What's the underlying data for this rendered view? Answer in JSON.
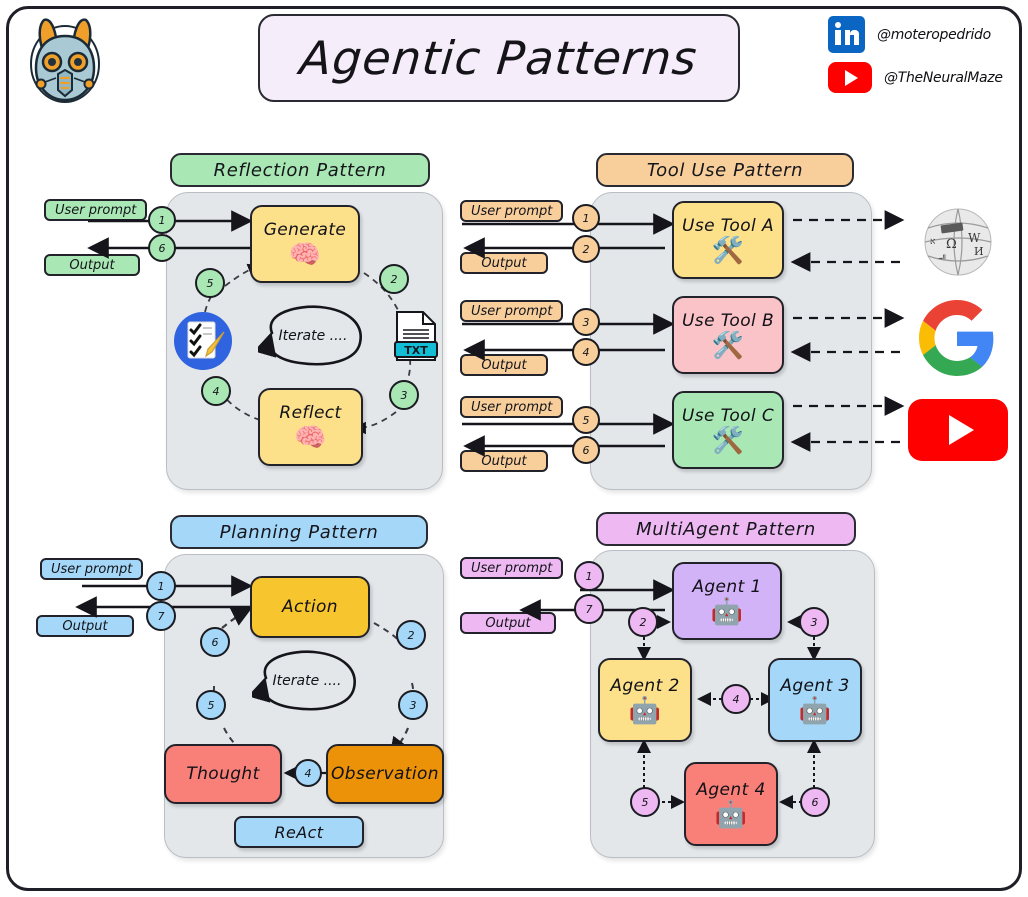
{
  "header": {
    "title": "Agentic Patterns",
    "logo_icon": "robot-rabbit-logo",
    "socials": [
      {
        "icon": "linkedin-icon",
        "handle": "@moteropedrido"
      },
      {
        "icon": "youtube-icon",
        "handle": "@TheNeuralMaze"
      }
    ]
  },
  "colors": {
    "reflection": "#a9e8b4",
    "tool_use": "#f8cf9b",
    "planning": "#a5d8f8",
    "multiagent": "#eeb9f2",
    "panel_bg": "#e3e7ea",
    "node_yellow": "#fce08a",
    "node_pink": "#f9c3c7",
    "node_green": "#a9e8b4",
    "node_amber": "#f7c52d",
    "node_orange": "#ec9208",
    "node_red": "#f88078",
    "node_purple": "#d2b3f7",
    "node_blue": "#a5d8f8",
    "title_banner_bg": "#f6edfa",
    "stroke": "#22222b"
  },
  "patterns": {
    "reflection": {
      "title": "Reflection Pattern",
      "io": [
        {
          "label": "User prompt"
        },
        {
          "label": "Output"
        }
      ],
      "nodes": [
        {
          "label": "Generate",
          "icon": "brain-icon"
        },
        {
          "label": "Reflect",
          "icon": "brain-icon"
        }
      ],
      "assets": [
        {
          "icon": "checklist-pencil-icon"
        },
        {
          "icon": "txt-file-icon",
          "label": "TXT"
        }
      ],
      "iterate_label": "Iterate ....",
      "steps": [
        "1",
        "6",
        "5",
        "2",
        "4",
        "3"
      ]
    },
    "tool_use": {
      "title": "Tool Use Pattern",
      "io": [
        {
          "label": "User prompt"
        },
        {
          "label": "Output"
        },
        {
          "label": "User prompt"
        },
        {
          "label": "Output"
        },
        {
          "label": "User prompt"
        },
        {
          "label": "Output"
        }
      ],
      "nodes": [
        {
          "label": "Use Tool A",
          "icon": "tools-icon"
        },
        {
          "label": "Use Tool B",
          "icon": "tools-icon"
        },
        {
          "label": "Use Tool C",
          "icon": "tools-icon"
        }
      ],
      "external": [
        {
          "icon": "wikipedia-icon"
        },
        {
          "icon": "google-icon"
        },
        {
          "icon": "youtube-icon"
        }
      ],
      "steps": [
        "1",
        "2",
        "3",
        "4",
        "5",
        "6"
      ]
    },
    "planning": {
      "title": "Planning Pattern",
      "io": [
        {
          "label": "User prompt"
        },
        {
          "label": "Output"
        }
      ],
      "nodes": [
        {
          "label": "Action"
        },
        {
          "label": "Observation"
        },
        {
          "label": "Thought"
        }
      ],
      "footer_label": "ReAct",
      "iterate_label": "Iterate ....",
      "steps": [
        "1",
        "7",
        "6",
        "2",
        "5",
        "3",
        "4"
      ]
    },
    "multiagent": {
      "title": "MultiAgent Pattern",
      "io": [
        {
          "label": "User prompt"
        },
        {
          "label": "Output"
        }
      ],
      "nodes": [
        {
          "label": "Agent 1",
          "icon": "robot-icon"
        },
        {
          "label": "Agent 2",
          "icon": "robot-icon"
        },
        {
          "label": "Agent 3",
          "icon": "robot-icon"
        },
        {
          "label": "Agent 4",
          "icon": "robot-icon"
        }
      ],
      "steps": [
        "1",
        "7",
        "2",
        "3",
        "4",
        "5",
        "6"
      ]
    }
  }
}
